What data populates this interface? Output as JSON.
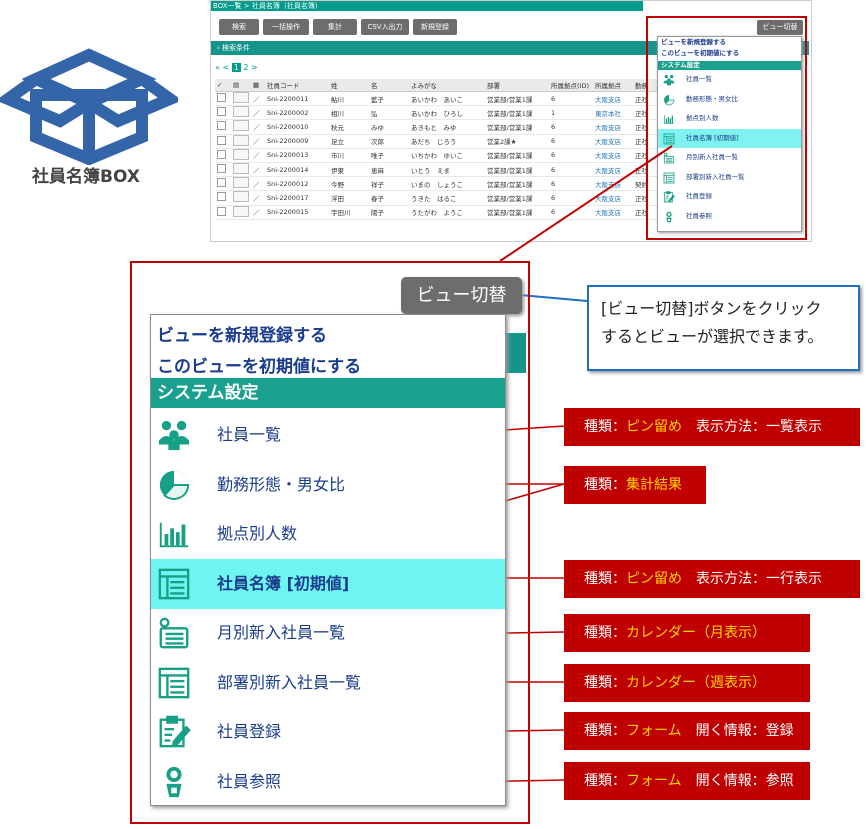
{
  "logo": {
    "title": "社員名簿BOX"
  },
  "screenshot": {
    "breadcrumb": "BOX一覧 > 社員名簿（社員名簿）",
    "toolbar": [
      "検索",
      "一括操作",
      "集計",
      "CSV入出力",
      "新規登録"
    ],
    "view_switch_button": "ビュー切替",
    "search_conditions": "検索条件",
    "pager": {
      "first": "«",
      "prev": "<",
      "current": "1",
      "next": "2",
      "last": ">"
    },
    "columns": [
      "社員コード",
      "姓",
      "名",
      "よみがな",
      "部署",
      "所属拠点(ID)",
      "所属拠点",
      "勤務"
    ],
    "rows": [
      [
        "Sni-2200011",
        "鮎川",
        "藍子",
        "あいかわ　あいこ",
        "営業部/営業1課",
        "6",
        "大阪支店",
        "正社"
      ],
      [
        "Sni-2200002",
        "相川",
        "弘",
        "あいかわ　ひろし",
        "営業部/営業1課",
        "1",
        "東京本社",
        "正社"
      ],
      [
        "Sni-2200010",
        "秋元",
        "みゆ",
        "あきもと　みゆ",
        "営業部/営業1課",
        "6",
        "大阪支店",
        "正社"
      ],
      [
        "Sni-2200009",
        "足立",
        "次郎",
        "あだち　じろう",
        "営業2課★",
        "6",
        "大阪支店",
        "正社"
      ],
      [
        "Sni-2200013",
        "市川",
        "唯子",
        "いちかわ　ゆいこ",
        "営業部/営業1課",
        "6",
        "大阪支店",
        "正社"
      ],
      [
        "Sni-2200014",
        "伊東",
        "恵麻",
        "いとう　えま",
        "営業部/営業1課",
        "6",
        "大阪支店",
        "正社"
      ],
      [
        "Sni-2200012",
        "今野",
        "祥子",
        "いまの　しょうこ",
        "営業部/営業1課",
        "6",
        "大阪支店",
        "契約"
      ],
      [
        "Sni-2200017",
        "浮田",
        "春子",
        "うきた　はるこ",
        "営業部/営業1課",
        "6",
        "大阪支店",
        "正社"
      ],
      [
        "Sni-2200015",
        "宇田川",
        "陽子",
        "うたがわ　ようこ",
        "営業部/営業1課",
        "6",
        "大阪支店",
        "正社"
      ]
    ]
  },
  "view_menu": {
    "button": "ビュー切替",
    "register_new": "ビューを新規登録する",
    "set_default": "このビューを初期値にする",
    "system_settings": "システム設定",
    "items": [
      {
        "label": "社員一覧",
        "icon": "people-group-icon"
      },
      {
        "label": "勤務形態・男女比",
        "icon": "pie-chart-icon"
      },
      {
        "label": "拠点別人数",
        "icon": "bar-chart-icon"
      },
      {
        "label": "社員名簿 [初期値]",
        "icon": "table-icon",
        "selected": true
      },
      {
        "label": "月別新入社員一覧",
        "icon": "list-icon"
      },
      {
        "label": "部署別新入社員一覧",
        "icon": "table-icon"
      },
      {
        "label": "社員登録",
        "icon": "clipboard-edit-icon"
      },
      {
        "label": "社員参照",
        "icon": "person-badge-icon"
      }
    ]
  },
  "callout": {
    "line1": "[ビュー切替]ボタンをクリック",
    "line2": "するとビューが選択できます。"
  },
  "tags": [
    {
      "prefix": "種類：",
      "type": "ピン留め",
      "rest": "　表示方法：一覧表示"
    },
    {
      "prefix": "種類：",
      "type": "集計結果",
      "rest": ""
    },
    {
      "prefix": "種類：",
      "type": "ピン留め",
      "rest": "　表示方法：一行表示"
    },
    {
      "prefix": "種類：",
      "type": "カレンダー（月表示）",
      "rest": ""
    },
    {
      "prefix": "種類：",
      "type": "カレンダー（週表示）",
      "rest": ""
    },
    {
      "prefix": "種類：",
      "type": "フォーム",
      "rest": "　開く情報：登録"
    },
    {
      "prefix": "種類：",
      "type": "フォーム",
      "rest": "　開く情報：参照"
    }
  ],
  "colors": {
    "accent": "#1aa08e",
    "highlight": "#6ef5f2",
    "link": "#1a3c8c",
    "tag_bg": "#c00000",
    "tag_type": "#ffd700"
  }
}
